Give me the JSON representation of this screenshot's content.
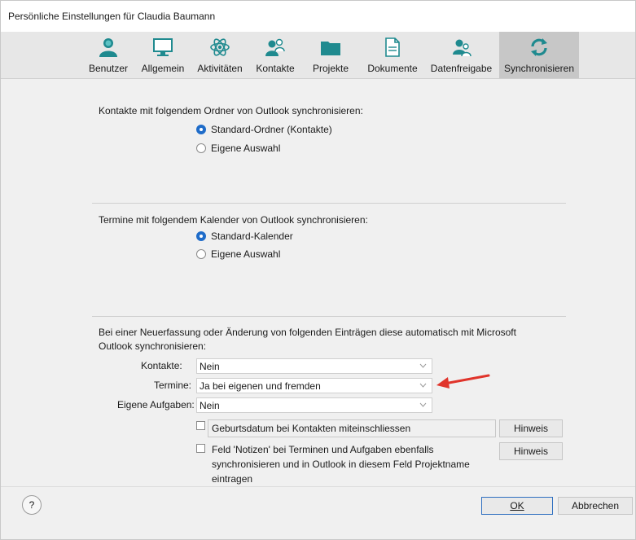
{
  "window": {
    "title": "Persönliche Einstellungen für Claudia Baumann"
  },
  "toolbar": {
    "items": [
      {
        "label": "Benutzer",
        "icon": "user-icon",
        "active": false
      },
      {
        "label": "Allgemein",
        "icon": "monitor-icon",
        "active": false
      },
      {
        "label": "Aktivitäten",
        "icon": "atom-icon",
        "active": false
      },
      {
        "label": "Kontakte",
        "icon": "contacts-icon",
        "active": false
      },
      {
        "label": "Projekte",
        "icon": "folder-icon",
        "active": false
      },
      {
        "label": "Dokumente",
        "icon": "document-icon",
        "active": false
      },
      {
        "label": "Datenfreigabe",
        "icon": "share-users-icon",
        "active": false
      },
      {
        "label": "Synchronisieren",
        "icon": "sync-icon",
        "active": true
      }
    ]
  },
  "contacts_section": {
    "heading": "Kontakte mit folgendem Ordner von Outlook synchronisieren:",
    "options": [
      {
        "label": "Standard-Ordner (Kontakte)",
        "selected": true
      },
      {
        "label": "Eigene Auswahl",
        "selected": false
      }
    ]
  },
  "calendar_section": {
    "heading": "Termine mit folgendem Kalender von Outlook synchronisieren:",
    "options": [
      {
        "label": "Standard-Kalender",
        "selected": true
      },
      {
        "label": "Eigene Auswahl",
        "selected": false
      }
    ]
  },
  "auto_section": {
    "heading_line1": "Bei einer Neuerfassung oder Änderung von folgenden Einträgen diese automatisch mit Microsoft",
    "heading_line2": "Outlook synchronisieren:",
    "rows": [
      {
        "label": "Kontakte:",
        "value": "Nein"
      },
      {
        "label": "Termine:",
        "value": "Ja bei eigenen und fremden"
      },
      {
        "label": "Eigene Aufgaben:",
        "value": "Nein"
      }
    ],
    "checkbox1": {
      "label": "Geburtsdatum bei Kontakten miteinschliessen",
      "checked": false,
      "hint": "Hinweis"
    },
    "checkbox2": {
      "line1": "Feld 'Notizen' bei Terminen und Aufgaben ebenfalls",
      "line2": "synchronisieren und in Outlook in diesem Feld Projektname",
      "line3": "eintragen",
      "checked": false,
      "hint": "Hinweis"
    }
  },
  "footer": {
    "help": "?",
    "ok": "OK",
    "cancel": "Abbrechen"
  },
  "colors": {
    "accent": "#1f6cc9",
    "icon_teal": "#1f8a8f",
    "arrow": "#e0342b"
  }
}
